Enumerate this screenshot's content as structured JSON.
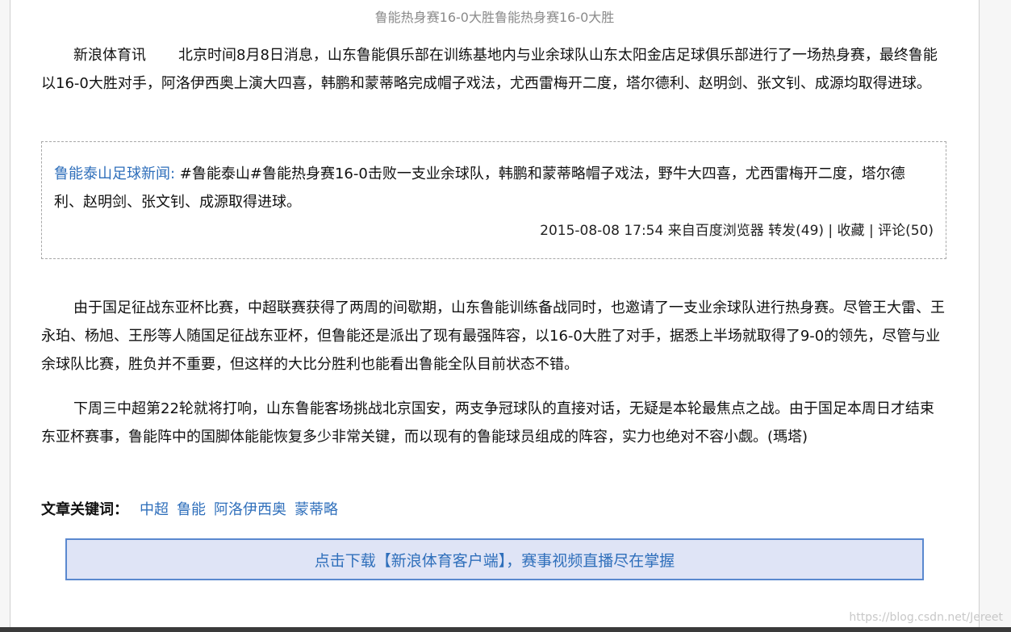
{
  "article": {
    "image_caption": "鲁能热身赛16-0大胜鲁能热身赛16-0大胜",
    "para1_source": "新浪体育讯",
    "para1_text": "北京时间8月8日消息，山东鲁能俱乐部在训练基地内与业余球队山东太阳金店足球俱乐部进行了一场热身赛，最终鲁能以16-0大胜对手，阿洛伊西奥上演大四喜，韩鹏和蒙蒂略完成帽子戏法，尤西雷梅开二度，塔尔德利、赵明剑、张文钊、成源均取得进球。",
    "quote": {
      "source": "鲁能泰山足球新闻:",
      "text": " #鲁能泰山#鲁能热身赛16-0击败一支业余球队，韩鹏和蒙蒂略帽子戏法，野牛大四喜，尤西雷梅开二度，塔尔德利、赵明剑、张文钊、成源取得进球。",
      "meta": "2015-08-08 17:54 来自百度浏览器 转发(49) | 收藏 | 评论(50)"
    },
    "para2": "由于国足征战东亚杯比赛，中超联赛获得了两周的间歇期，山东鲁能训练备战同时，也邀请了一支业余球队进行热身赛。尽管王大雷、王永珀、杨旭、王彤等人随国足征战东亚杯，但鲁能还是派出了现有最强阵容，以16-0大胜了对手，据悉上半场就取得了9-0的领先，尽管与业余球队比赛，胜负并不重要，但这样的大比分胜利也能看出鲁能全队目前状态不错。",
    "para3": "下周三中超第22轮就将打响，山东鲁能客场挑战北京国安，两支争冠球队的直接对话，无疑是本轮最焦点之战。由于国足本周日才结束东亚杯赛事，鲁能阵中的国脚体能能恢复多少非常关键，而以现有的鲁能球员组成的阵容，实力也绝对不容小觑。(瑪塔)"
  },
  "keywords": {
    "label": "文章关键词：",
    "items": [
      "中超",
      "鲁能",
      "阿洛伊西奥",
      "蒙蒂略"
    ]
  },
  "banner": {
    "text": "点击下载【新浪体育客户端】，赛事视频直播尽在掌握"
  },
  "watermark": "https://blog.csdn.net/Jereet",
  "colors": {
    "link": "#2f6fbb",
    "banner_bg": "#dfe4f6",
    "banner_border": "#5a88cf"
  }
}
